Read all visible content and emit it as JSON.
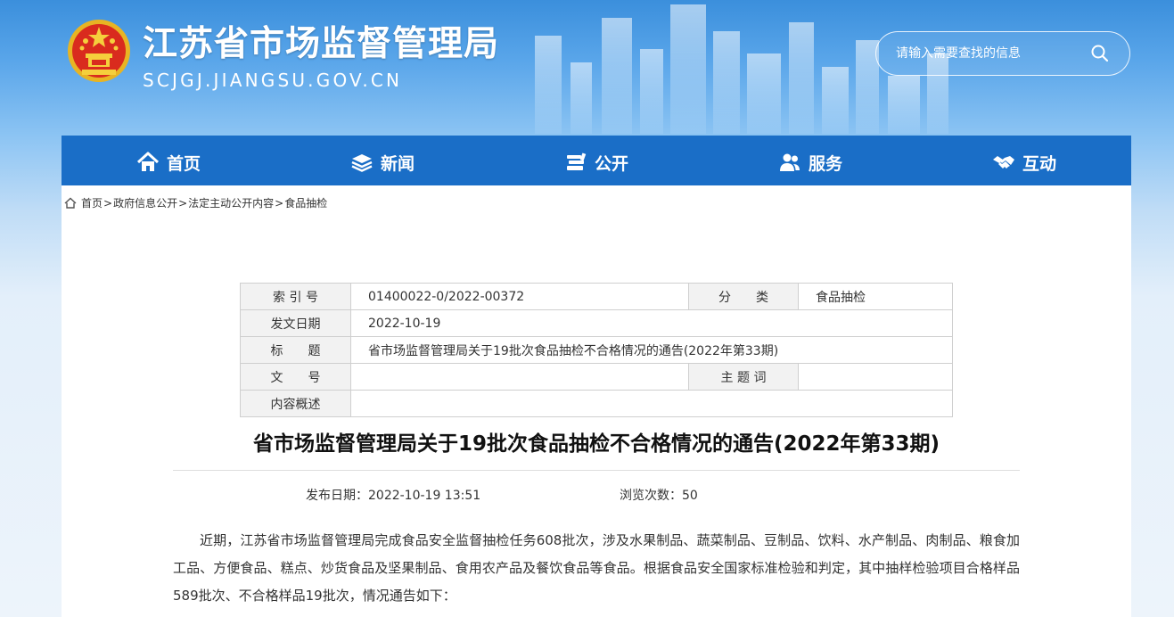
{
  "header": {
    "site_title": "江苏省市场监督管理局",
    "site_domain": "SCJGJ.JIANGSU.GOV.CN",
    "search_placeholder": "请输入需要查找的信息"
  },
  "nav": {
    "items": [
      {
        "label": "首页",
        "icon": "home-icon"
      },
      {
        "label": "新闻",
        "icon": "layers-icon"
      },
      {
        "label": "公开",
        "icon": "books-icon"
      },
      {
        "label": "服务",
        "icon": "people-icon"
      },
      {
        "label": "互动",
        "icon": "handshake-icon"
      }
    ]
  },
  "breadcrumb": {
    "items": [
      "首页",
      "政府信息公开",
      "法定主动公开内容",
      "食品抽检"
    ],
    "separator": ">"
  },
  "meta": {
    "index_label": "索 引 号",
    "index_value": "01400022-0/2022-00372",
    "category_label": "分　　类",
    "category_value": "食品抽检",
    "date_label": "发文日期",
    "date_value": "2022-10-19",
    "title_label": "标　　题",
    "title_value": "省市场监督管理局关于19批次食品抽检不合格情况的通告(2022年第33期)",
    "doc_no_label": "文　　号",
    "doc_no_value": "",
    "keyword_label": "主 题 词",
    "keyword_value": "",
    "summary_label": "内容概述",
    "summary_value": ""
  },
  "article": {
    "title": "省市场监督管理局关于19批次食品抽检不合格情况的通告(2022年第33期)",
    "publish_label": "发布日期：",
    "publish_value": "2022-10-19 13:51",
    "views_label": "浏览次数：",
    "views_value": "50",
    "body": "近期，江苏省市场监督管理局完成食品安全监督抽检任务608批次，涉及水果制品、蔬菜制品、豆制品、饮料、水产制品、肉制品、粮食加工品、方便食品、糕点、炒货食品及坚果制品、食用农产品及餐饮食品等食品。根据食品安全国家标准检验和判定，其中抽样检验项目合格样品589批次、不合格样品19批次，情况通告如下："
  },
  "colors": {
    "nav_bg": "#1a6ec7",
    "banner_top": "#3b8fdc",
    "text": "#333333"
  }
}
